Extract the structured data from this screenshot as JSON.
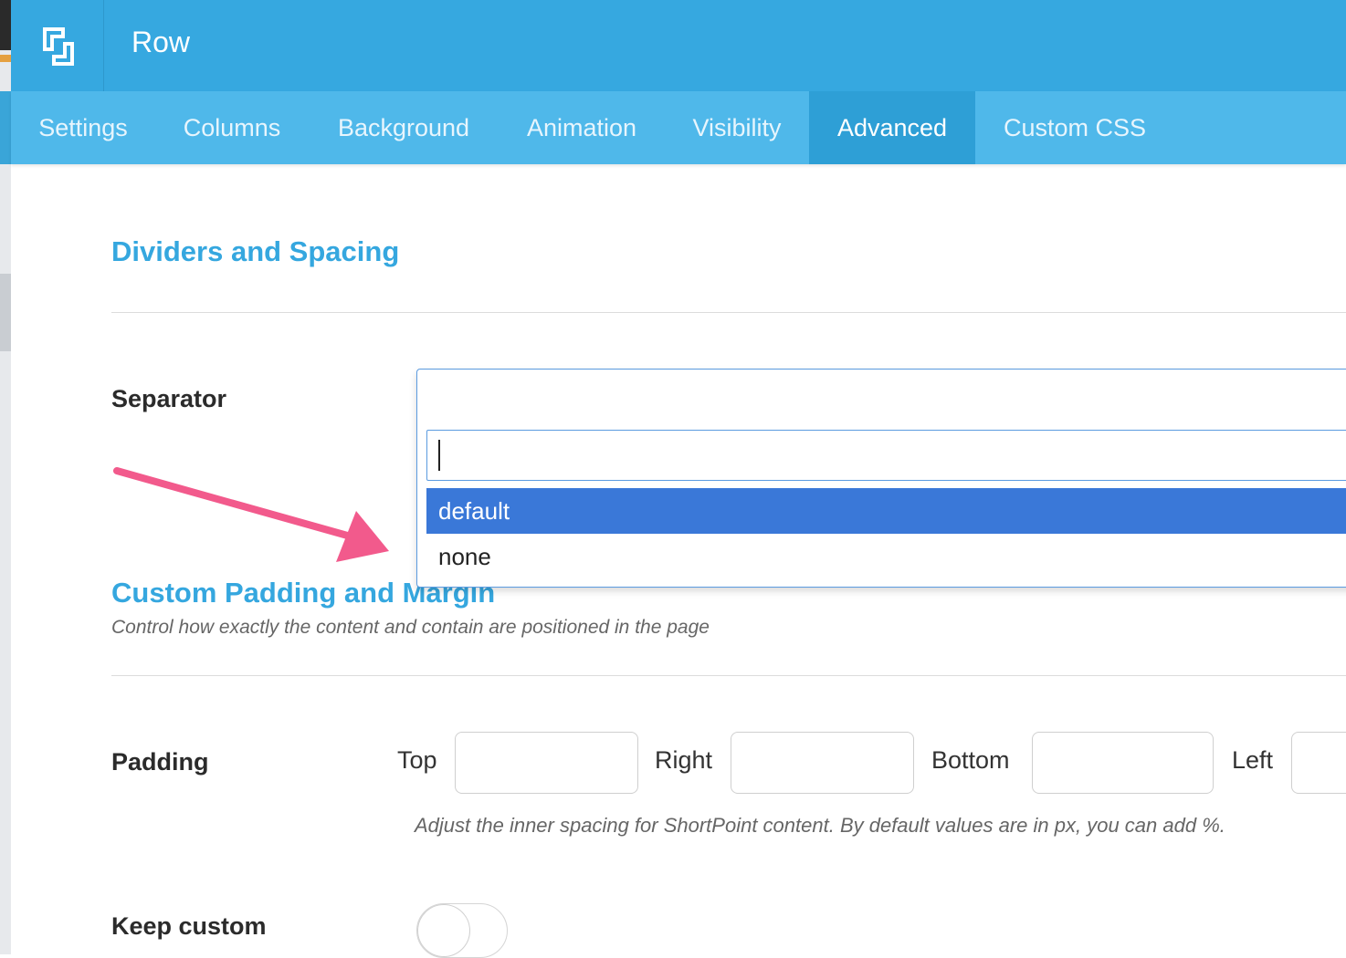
{
  "header": {
    "logo_icon": "shortpoint-logo-icon",
    "title": "Row"
  },
  "tabs": [
    {
      "label": "Settings",
      "active": false
    },
    {
      "label": "Columns",
      "active": false
    },
    {
      "label": "Background",
      "active": false
    },
    {
      "label": "Animation",
      "active": false
    },
    {
      "label": "Visibility",
      "active": false
    },
    {
      "label": "Advanced",
      "active": true
    },
    {
      "label": "Custom CSS",
      "active": false
    }
  ],
  "dividers_section": {
    "title": "Dividers and Spacing",
    "separator": {
      "label": "Separator",
      "search_value": "",
      "options": [
        "default",
        "none"
      ],
      "highlighted_option": "default"
    }
  },
  "padding_section": {
    "title": "Custom Padding and Margin",
    "subtitle": "Control how exactly the content and contain are positioned in the page",
    "padding": {
      "label": "Padding",
      "top_label": "Top",
      "right_label": "Right",
      "bottom_label": "Bottom",
      "left_label": "Left",
      "top_value": "",
      "right_value": "",
      "bottom_value": "",
      "left_value": "",
      "hint": "Adjust the inner spacing for ShortPoint content. By default values are in px, you can add %."
    },
    "keep_custom": {
      "label": "Keep custom",
      "enabled": false
    }
  },
  "colors": {
    "header_bg": "#36a8e0",
    "tabs_bg": "#4fb8ea",
    "active_tab_bg": "#2e9fd6",
    "section_title": "#35a7df",
    "highlight_option": "#3a78d8",
    "annotation_arrow": "#f25a8c"
  },
  "annotation": {
    "icon": "pink-arrow-icon"
  }
}
